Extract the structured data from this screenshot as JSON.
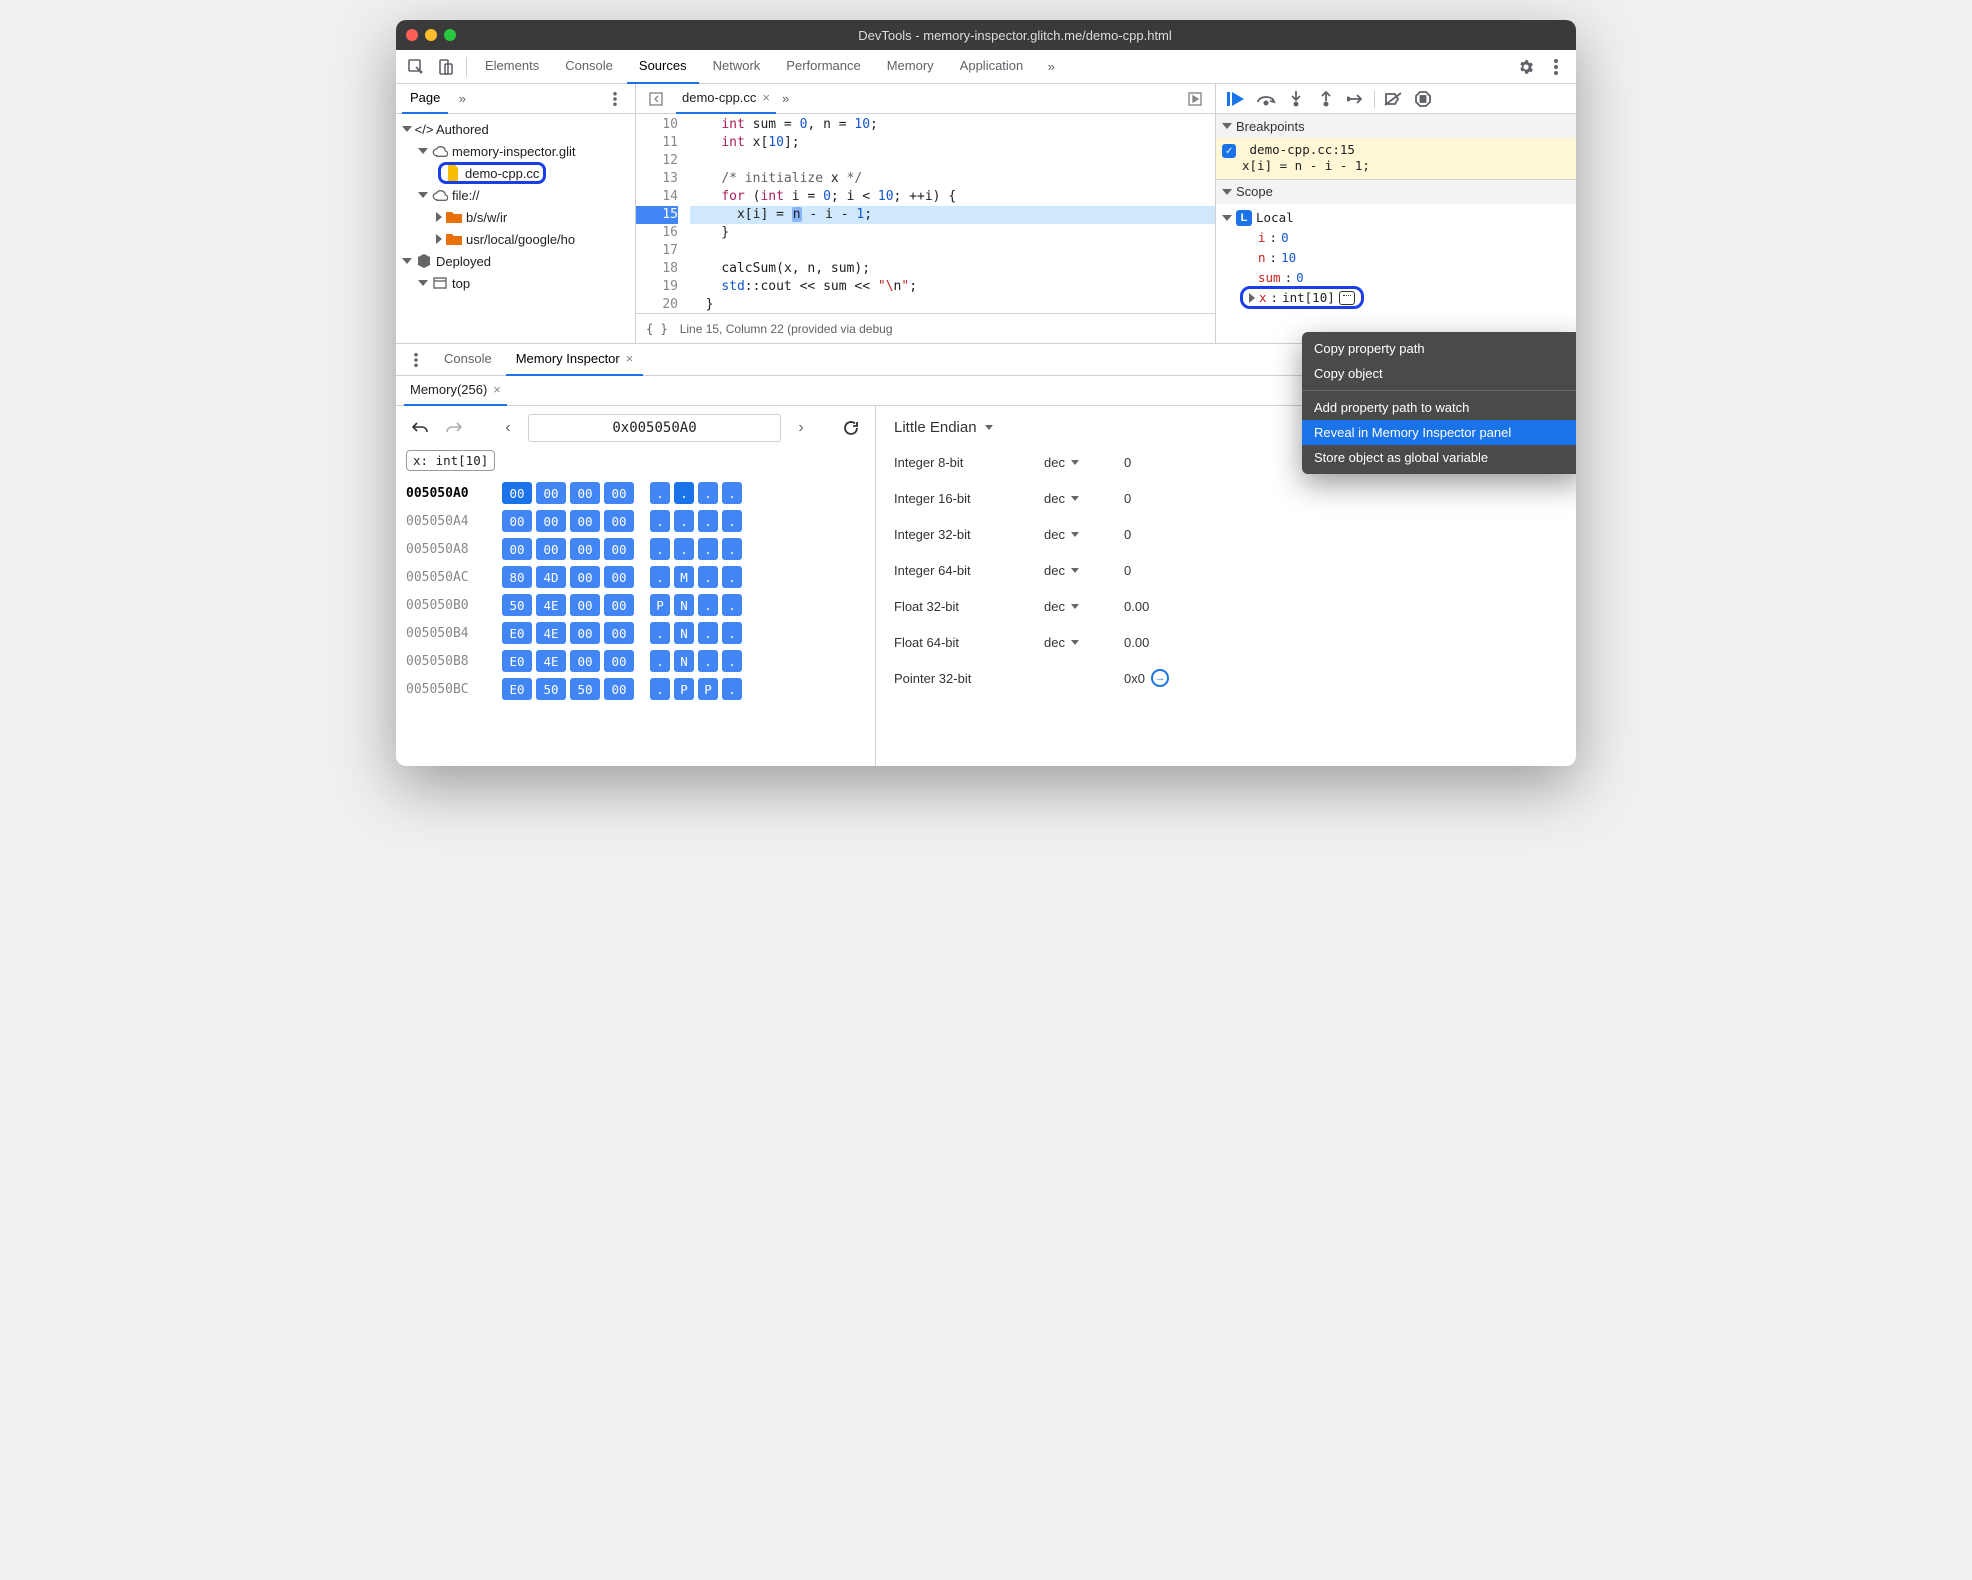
{
  "window_title": "DevTools - memory-inspector.glitch.me/demo-cpp.html",
  "main_tabs": [
    "Elements",
    "Console",
    "Sources",
    "Network",
    "Performance",
    "Memory",
    "Application"
  ],
  "main_tab_active": "Sources",
  "left": {
    "tab": "Page",
    "tree": {
      "authored": "Authored",
      "domain": "memory-inspector.glit",
      "file": "demo-cpp.cc",
      "file_proto": "file://",
      "dir1": "b/s/w/ir",
      "dir2": "usr/local/google/ho",
      "deployed": "Deployed",
      "top": "top"
    }
  },
  "editor": {
    "tab": "demo-cpp.cc",
    "first_line": 10,
    "lines": [
      "    int sum = 0, n = 10;",
      "    int x[10];",
      "",
      "    /* initialize x */",
      "    for (int i = 0; i < 10; ++i) {",
      "      x[i] = n - i - 1;",
      "    }",
      "",
      "    calcSum(x, n, sum);",
      "    std::cout << sum << \"\\n\";",
      "  }"
    ],
    "hl_line": 15,
    "status": "Line 15, Column 22  (provided via debug"
  },
  "debugger": {
    "breakpoints_hdr": "Breakpoints",
    "bp_label": "demo-cpp.cc:15",
    "bp_code": "x[i] = n - i - 1;",
    "scope_hdr": "Scope",
    "local_label": "Local",
    "vars": [
      {
        "name": "i",
        "value": "0"
      },
      {
        "name": "n",
        "value": "10"
      },
      {
        "name": "sum",
        "value": "0"
      }
    ],
    "x_name": "x",
    "x_type": "int[10]"
  },
  "context_menu": {
    "items": [
      "Copy property path",
      "Copy object",
      "Add property path to watch",
      "Reveal in Memory Inspector panel",
      "Store object as global variable"
    ],
    "selected": "Reveal in Memory Inspector panel"
  },
  "drawer": {
    "tabs": [
      "Console",
      "Memory Inspector"
    ],
    "active": "Memory Inspector",
    "subtab": "Memory(256)",
    "address": "0x005050A0",
    "chip": "x: int[10]",
    "rows": [
      {
        "addr": "005050A0",
        "bytes": [
          "00",
          "00",
          "00",
          "00"
        ],
        "ascii": [
          ".",
          ".",
          ".",
          "."
        ],
        "cur": true
      },
      {
        "addr": "005050A4",
        "bytes": [
          "00",
          "00",
          "00",
          "00"
        ],
        "ascii": [
          ".",
          ".",
          ".",
          "."
        ]
      },
      {
        "addr": "005050A8",
        "bytes": [
          "00",
          "00",
          "00",
          "00"
        ],
        "ascii": [
          ".",
          ".",
          ".",
          "."
        ]
      },
      {
        "addr": "005050AC",
        "bytes": [
          "80",
          "4D",
          "00",
          "00"
        ],
        "ascii": [
          ".",
          "M",
          ".",
          "."
        ]
      },
      {
        "addr": "005050B0",
        "bytes": [
          "50",
          "4E",
          "00",
          "00"
        ],
        "ascii": [
          "P",
          "N",
          ".",
          "."
        ]
      },
      {
        "addr": "005050B4",
        "bytes": [
          "E0",
          "4E",
          "00",
          "00"
        ],
        "ascii": [
          ".",
          "N",
          ".",
          "."
        ]
      },
      {
        "addr": "005050B8",
        "bytes": [
          "E0",
          "4E",
          "00",
          "00"
        ],
        "ascii": [
          ".",
          "N",
          ".",
          "."
        ]
      },
      {
        "addr": "005050BC",
        "bytes": [
          "E0",
          "50",
          "50",
          "00"
        ],
        "ascii": [
          ".",
          "P",
          "P",
          "."
        ]
      }
    ],
    "endian": "Little Endian",
    "values": [
      {
        "label": "Integer 8-bit",
        "fmt": "dec",
        "value": "0"
      },
      {
        "label": "Integer 16-bit",
        "fmt": "dec",
        "value": "0"
      },
      {
        "label": "Integer 32-bit",
        "fmt": "dec",
        "value": "0"
      },
      {
        "label": "Integer 64-bit",
        "fmt": "dec",
        "value": "0"
      },
      {
        "label": "Float 32-bit",
        "fmt": "dec",
        "value": "0.00"
      },
      {
        "label": "Float 64-bit",
        "fmt": "dec",
        "value": "0.00"
      },
      {
        "label": "Pointer 32-bit",
        "fmt": "",
        "value": "0x0"
      }
    ]
  }
}
